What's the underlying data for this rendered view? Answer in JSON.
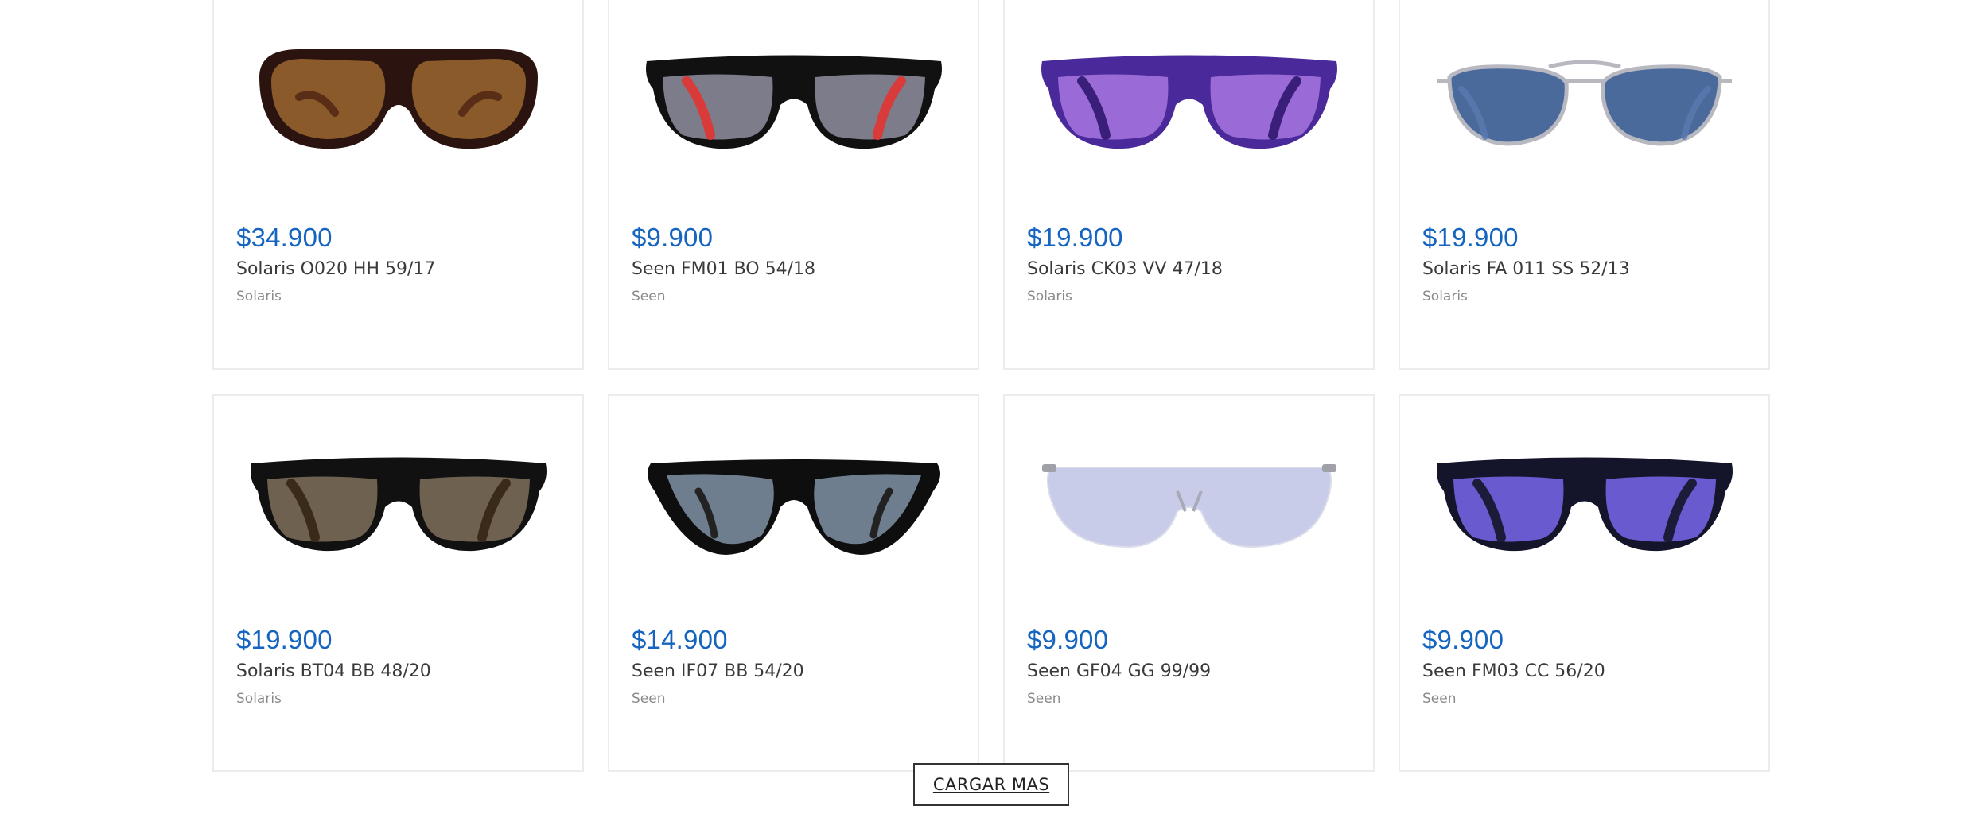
{
  "products": [
    {
      "price": "$34.900",
      "name": "Solaris O020 HH 59/17",
      "brand": "Solaris",
      "style": "oversized-butterfly",
      "frame_color": "#2b1410",
      "lens_color": "#8a5a2a",
      "temple_color": "#5a2e16"
    },
    {
      "price": "$9.900",
      "name": "Seen FM01 BO 54/18",
      "brand": "Seen",
      "style": "wayfarer",
      "frame_color": "#111111",
      "lens_color": "#7c7c8a",
      "temple_color": "#d93a3a"
    },
    {
      "price": "$19.900",
      "name": "Solaris CK03 VV 47/18",
      "brand": "Solaris",
      "style": "wayfarer",
      "frame_color": "#4a2a9a",
      "lens_color": "#9a6ad6",
      "temple_color": "#3a1f7a"
    },
    {
      "price": "$19.900",
      "name": "Solaris FA 011 SS 52/13",
      "brand": "Solaris",
      "style": "aviator",
      "frame_color": "#b8b8c0",
      "lens_color": "#4a6a9c",
      "temple_color": "#5a7ab0"
    },
    {
      "price": "$19.900",
      "name": "Solaris BT04 BB 48/20",
      "brand": "Solaris",
      "style": "wayfarer",
      "frame_color": "#111111",
      "lens_color": "#6e6150",
      "temple_color": "#3a2a1a"
    },
    {
      "price": "$14.900",
      "name": "Seen IF07 BB 54/20",
      "brand": "Seen",
      "style": "cat-eye",
      "frame_color": "#0e0e0e",
      "lens_color": "#6e7e8e",
      "temple_color": "#222222"
    },
    {
      "price": "$9.900",
      "name": "Seen GF04 GG 99/99",
      "brand": "Seen",
      "style": "shield",
      "frame_color": "#a0a0a8",
      "lens_color": "#c8cce8",
      "temple_color": "#a8aab8"
    },
    {
      "price": "$9.900",
      "name": "Seen FM03 CC 56/20",
      "brand": "Seen",
      "style": "wayfarer",
      "frame_color": "#14142a",
      "lens_color": "#6a5ad0",
      "temple_color": "#1c1c3a"
    }
  ],
  "load_more_label": "CARGAR MAS"
}
